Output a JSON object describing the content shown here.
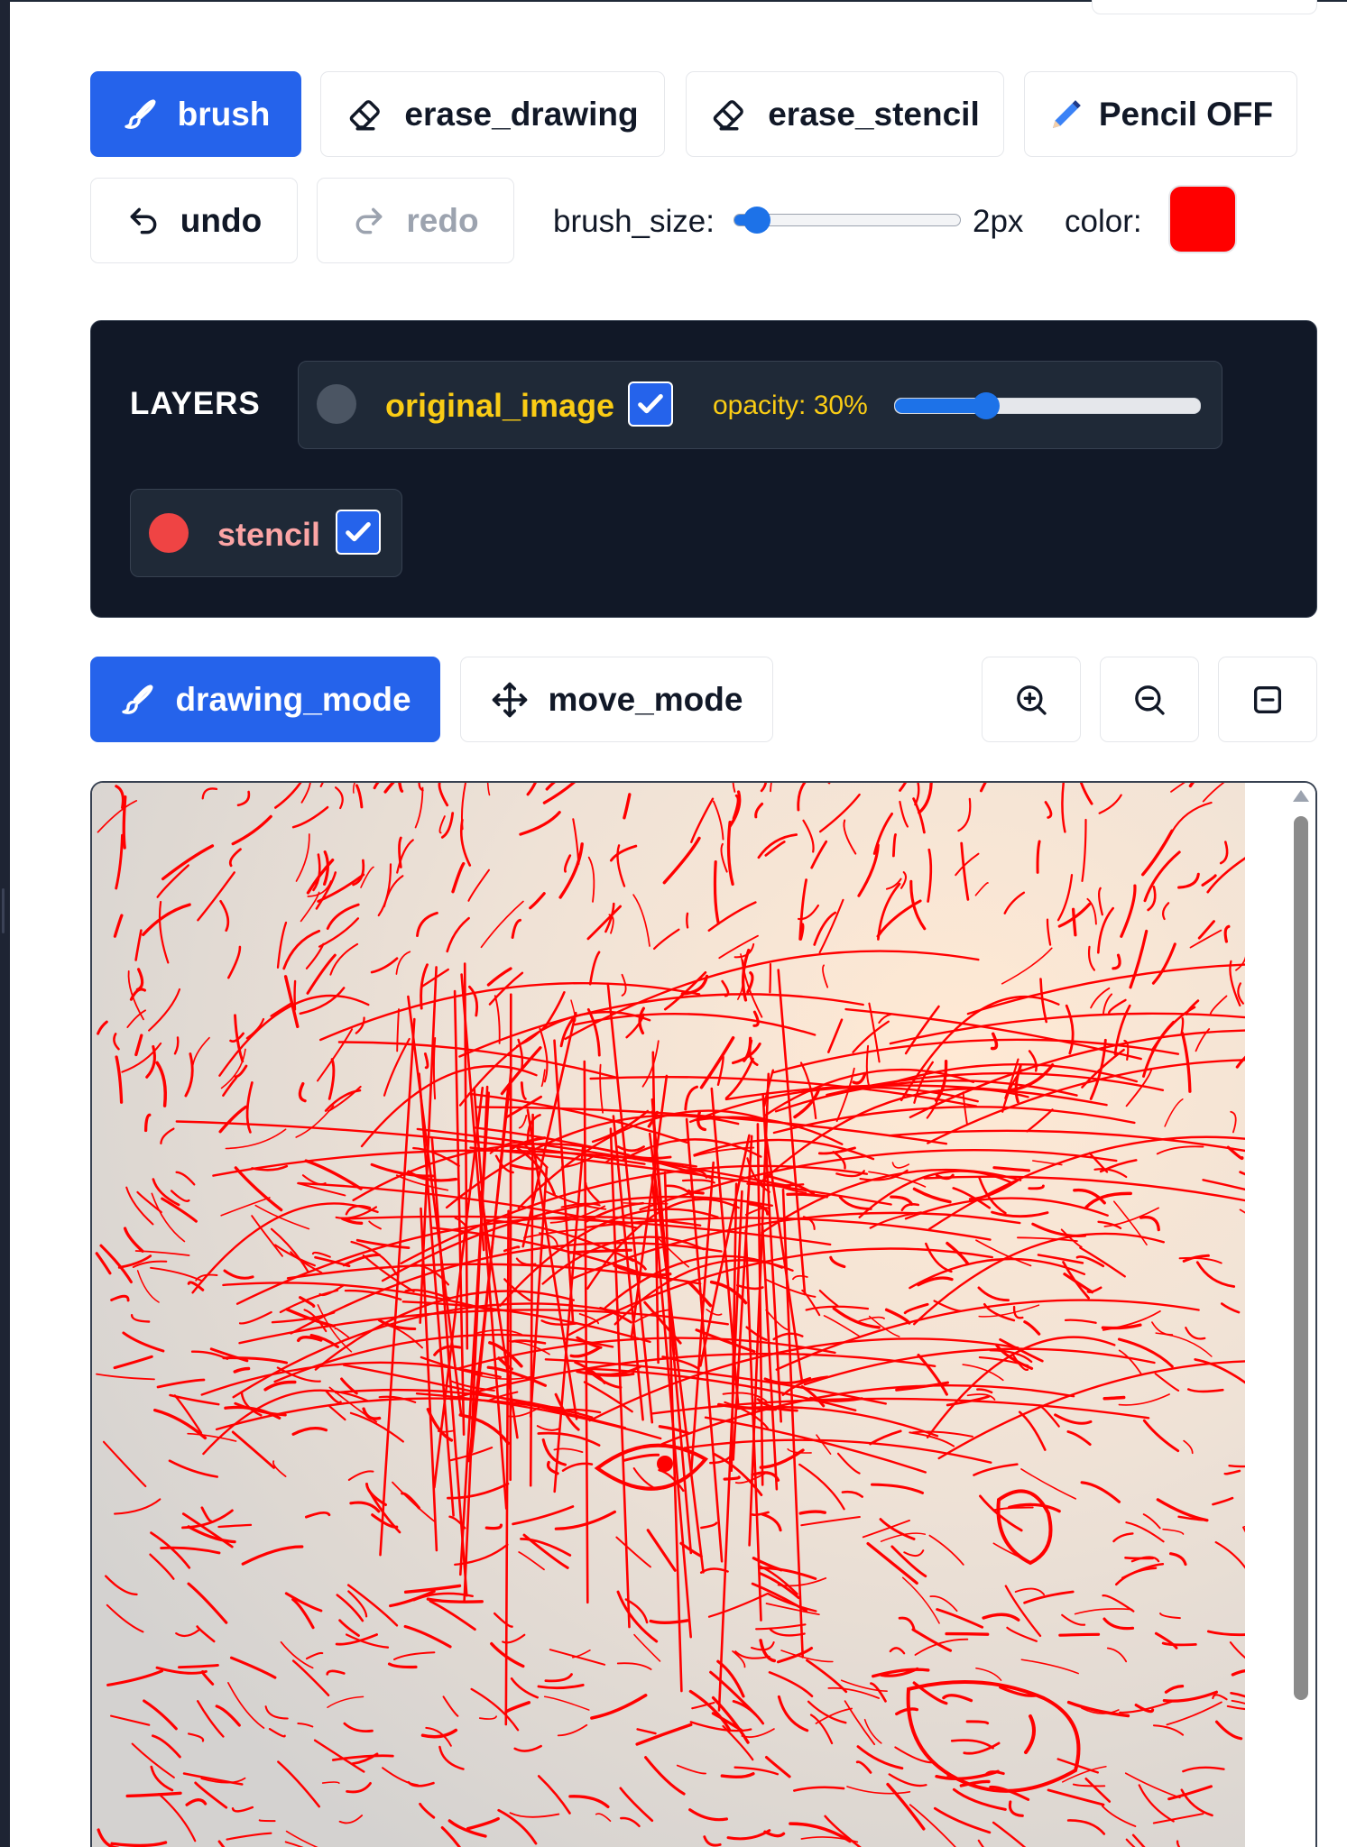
{
  "toolbar": {
    "brush_label": "brush",
    "erase_drawing_label": "erase_drawing",
    "erase_stencil_label": "erase_stencil",
    "pencil_label": "Pencil OFF",
    "undo_label": "undo",
    "redo_label": "redo",
    "brush_size_label": "brush_size:",
    "brush_size_value": "2px",
    "brush_size_fraction": 0.1,
    "color_label": "color:",
    "color_value": "#ff0000"
  },
  "layers": {
    "title": "LAYERS",
    "items": [
      {
        "name": "original_image",
        "checked": true,
        "dot_color": "#4b5563",
        "label_color": "#facc15"
      },
      {
        "name": "stencil",
        "checked": true,
        "dot_color": "#ef4444",
        "label_color": "#fca5a5"
      }
    ],
    "opacity_label": "opacity: 30%",
    "opacity_fraction": 0.3
  },
  "modes": {
    "drawing_label": "drawing_mode",
    "move_label": "move_mode",
    "zoom_in_icon": "zoom-in-icon",
    "zoom_out_icon": "zoom-out-icon",
    "fit_icon": "minus-square-icon"
  },
  "canvas": {
    "stroke_color": "#ff0000",
    "background_colors": [
      "#f7e9dc",
      "#d9d5d0",
      "#ffe7cf"
    ]
  },
  "colors": {
    "accent": "#2563eb",
    "panel": "#111827"
  }
}
